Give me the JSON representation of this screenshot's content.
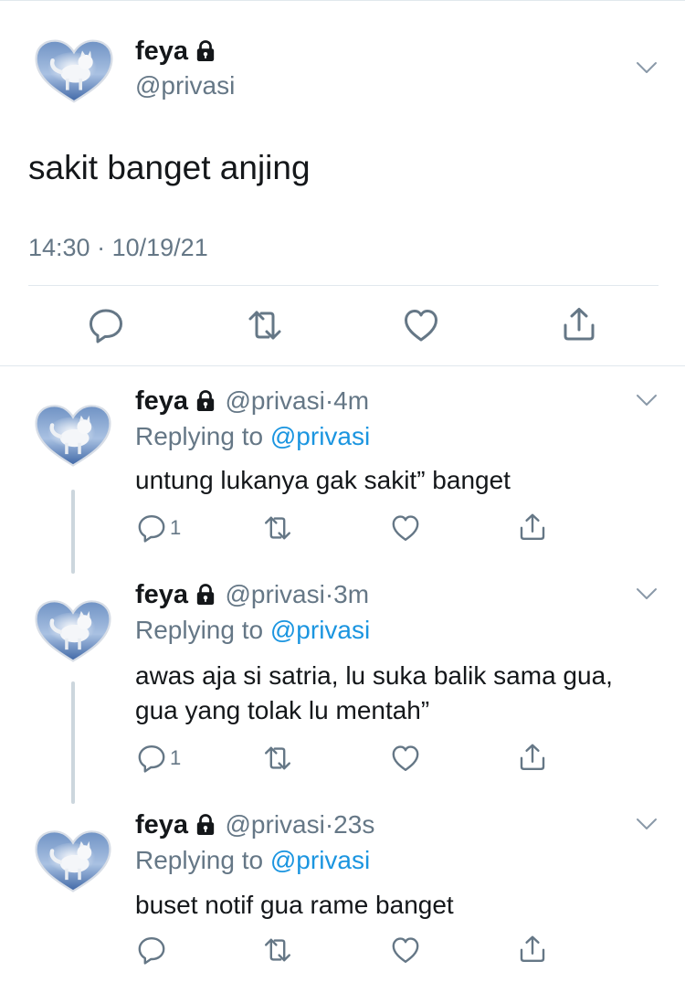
{
  "main_tweet": {
    "display_name": "feya",
    "handle": "@privasi",
    "text": "sakit banget anjing",
    "time": "14:30",
    "separator": "·",
    "date": "10/19/21",
    "avatar_icon": "heart-cat-avatar",
    "lock_icon": "lock-icon"
  },
  "replies": [
    {
      "display_name": "feya",
      "handle": "@privasi",
      "separator": "·",
      "age": "4m",
      "replying_to_label": "Replying to",
      "replying_to_handle": "@privasi",
      "text_lines": [
        "untung lukanya gak sakit” banget"
      ],
      "reply_count": "1"
    },
    {
      "display_name": "feya",
      "handle": "@privasi",
      "separator": "·",
      "age": "3m",
      "replying_to_label": "Replying to",
      "replying_to_handle": "@privasi",
      "text_lines": [
        "awas aja si satria, lu suka balik sama gua,",
        "gua yang tolak lu mentah”"
      ],
      "reply_count": "1"
    },
    {
      "display_name": "feya",
      "handle": "@privasi",
      "separator": "·",
      "age": "23s",
      "replying_to_label": "Replying to",
      "replying_to_handle": "@privasi",
      "text_lines": [
        "buset notif gua rame banget"
      ],
      "reply_count": ""
    }
  ],
  "colors": {
    "text": "#14171a",
    "secondary": "#657786",
    "link": "#1b95e0",
    "divider": "#e1e8ed",
    "thread_line": "#ccd6dd"
  }
}
